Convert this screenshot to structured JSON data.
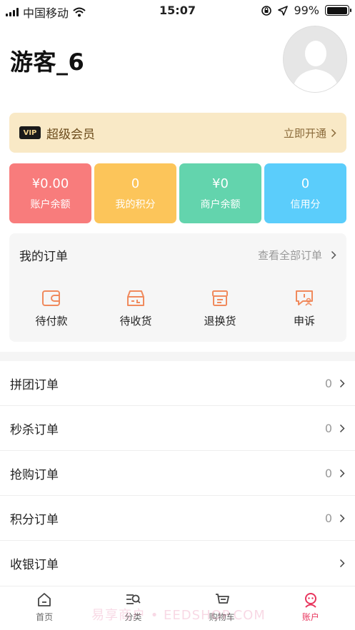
{
  "status_bar": {
    "carrier": "中国移动",
    "time": "15:07",
    "battery": "99%",
    "battery_level": 0.99
  },
  "profile": {
    "username": "游客_6"
  },
  "vip": {
    "badge": "VIP",
    "title": "超级会员",
    "action": "立即开通"
  },
  "stats": [
    {
      "value": "¥0.00",
      "label": "账户余额",
      "color": "#f87c7c"
    },
    {
      "value": "0",
      "label": "我的积分",
      "color": "#fcc55a"
    },
    {
      "value": "¥0",
      "label": "商户余额",
      "color": "#63d4ad"
    },
    {
      "value": "0",
      "label": "信用分",
      "color": "#5bcdfb"
    }
  ],
  "orders": {
    "title": "我的订单",
    "view_all": "查看全部订单",
    "items": [
      {
        "label": "待付款",
        "icon": "wallet-icon"
      },
      {
        "label": "待收货",
        "icon": "delivery-box-icon"
      },
      {
        "label": "退换货",
        "icon": "return-box-icon"
      },
      {
        "label": "申诉",
        "icon": "complaint-icon"
      }
    ],
    "accent": "#f08a5d"
  },
  "list": [
    {
      "label": "拼团订单",
      "count": "0"
    },
    {
      "label": "秒杀订单",
      "count": "0"
    },
    {
      "label": "抢购订单",
      "count": "0"
    },
    {
      "label": "积分订单",
      "count": "0"
    },
    {
      "label": "收银订单",
      "count": ""
    }
  ],
  "tabbar": [
    {
      "label": "首页",
      "icon": "home-icon",
      "active": false
    },
    {
      "label": "分类",
      "icon": "category-search-icon",
      "active": false
    },
    {
      "label": "购物车",
      "icon": "cart-icon",
      "active": false
    },
    {
      "label": "账户",
      "icon": "account-icon",
      "active": true
    }
  ],
  "watermark": "易享商户 • EEDSHOP.COM"
}
